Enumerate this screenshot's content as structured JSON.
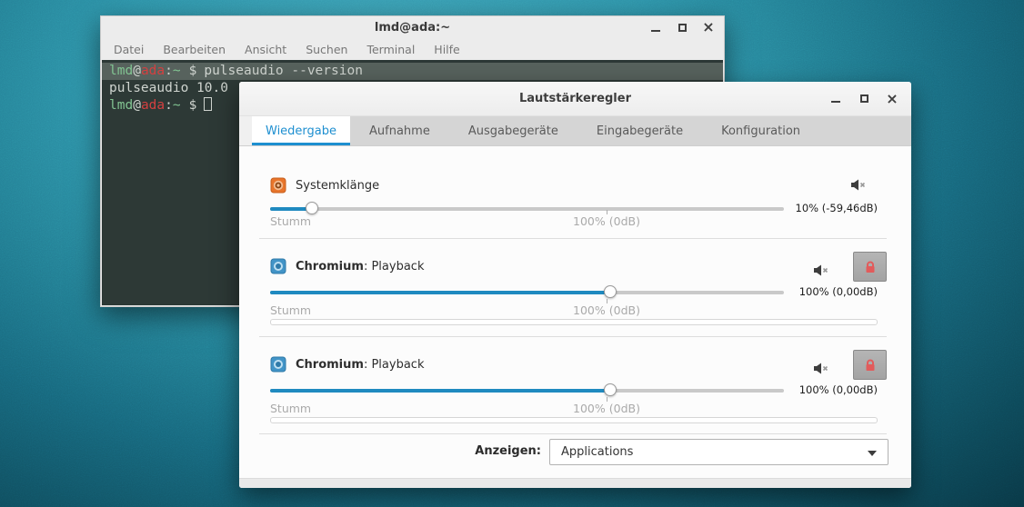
{
  "terminal": {
    "title": "lmd@ada:~",
    "menu_items": [
      "Datei",
      "Bearbeiten",
      "Ansicht",
      "Suchen",
      "Terminal",
      "Hilfe"
    ],
    "prompt_user": "lmd",
    "prompt_at": "@",
    "prompt_host": "ada",
    "prompt_sep": ":",
    "prompt_path": "~",
    "prompt_symbol": "$",
    "command": "pulseaudio --version",
    "output_line": "pulseaudio 10.0"
  },
  "mixer": {
    "title": "Lautstärkeregler",
    "active_tab": "Wiedergabe",
    "tabs": [
      {
        "label": "Wiedergabe"
      },
      {
        "label": "Aufnahme"
      },
      {
        "label": "Ausgabegeräte"
      },
      {
        "label": "Eingabegeräte"
      },
      {
        "label": "Konfiguration"
      }
    ],
    "streams": [
      {
        "icon": "system-sounds-icon",
        "name": "Systemklänge",
        "suffix": "",
        "volume_fill": "8%",
        "value_label": "10% (-59,46dB)",
        "mute_label": "Stumm",
        "scale_label": "100% (0dB)",
        "muted": true,
        "has_lock": false
      },
      {
        "icon": "chromium-icon",
        "name": "Chromium",
        "suffix": ": Playback",
        "volume_fill": "66%",
        "value_label": "100% (0,00dB)",
        "mute_label": "Stumm",
        "scale_label": "100% (0dB)",
        "muted": false,
        "has_lock": true
      },
      {
        "icon": "chromium-icon",
        "name": "Chromium",
        "suffix": ": Playback",
        "volume_fill": "66%",
        "value_label": "100% (0,00dB)",
        "mute_label": "Stumm",
        "scale_label": "100% (0dB)",
        "muted": false,
        "has_lock": true
      }
    ],
    "footer": {
      "label": "Anzeigen:",
      "dropdown_value": "Applications"
    }
  },
  "icons": {
    "close": "×",
    "minimize": "minimize-bar",
    "maximize": "maximize-box",
    "mute": "muted-speaker",
    "lock": "red-padlock",
    "dropdown_arrow": "triangle-down"
  },
  "colors": {
    "accent_blue": "#1e8fd0",
    "slider_fill_blue": "#1f8ac0",
    "lock_red": "#e25b5b",
    "system_icon_orange": "#e8752b",
    "chromium_icon_blue": "#4294c7",
    "terminal_green": "#82c492",
    "terminal_red": "#d34040",
    "desktop_teal": "#2e93a9"
  }
}
